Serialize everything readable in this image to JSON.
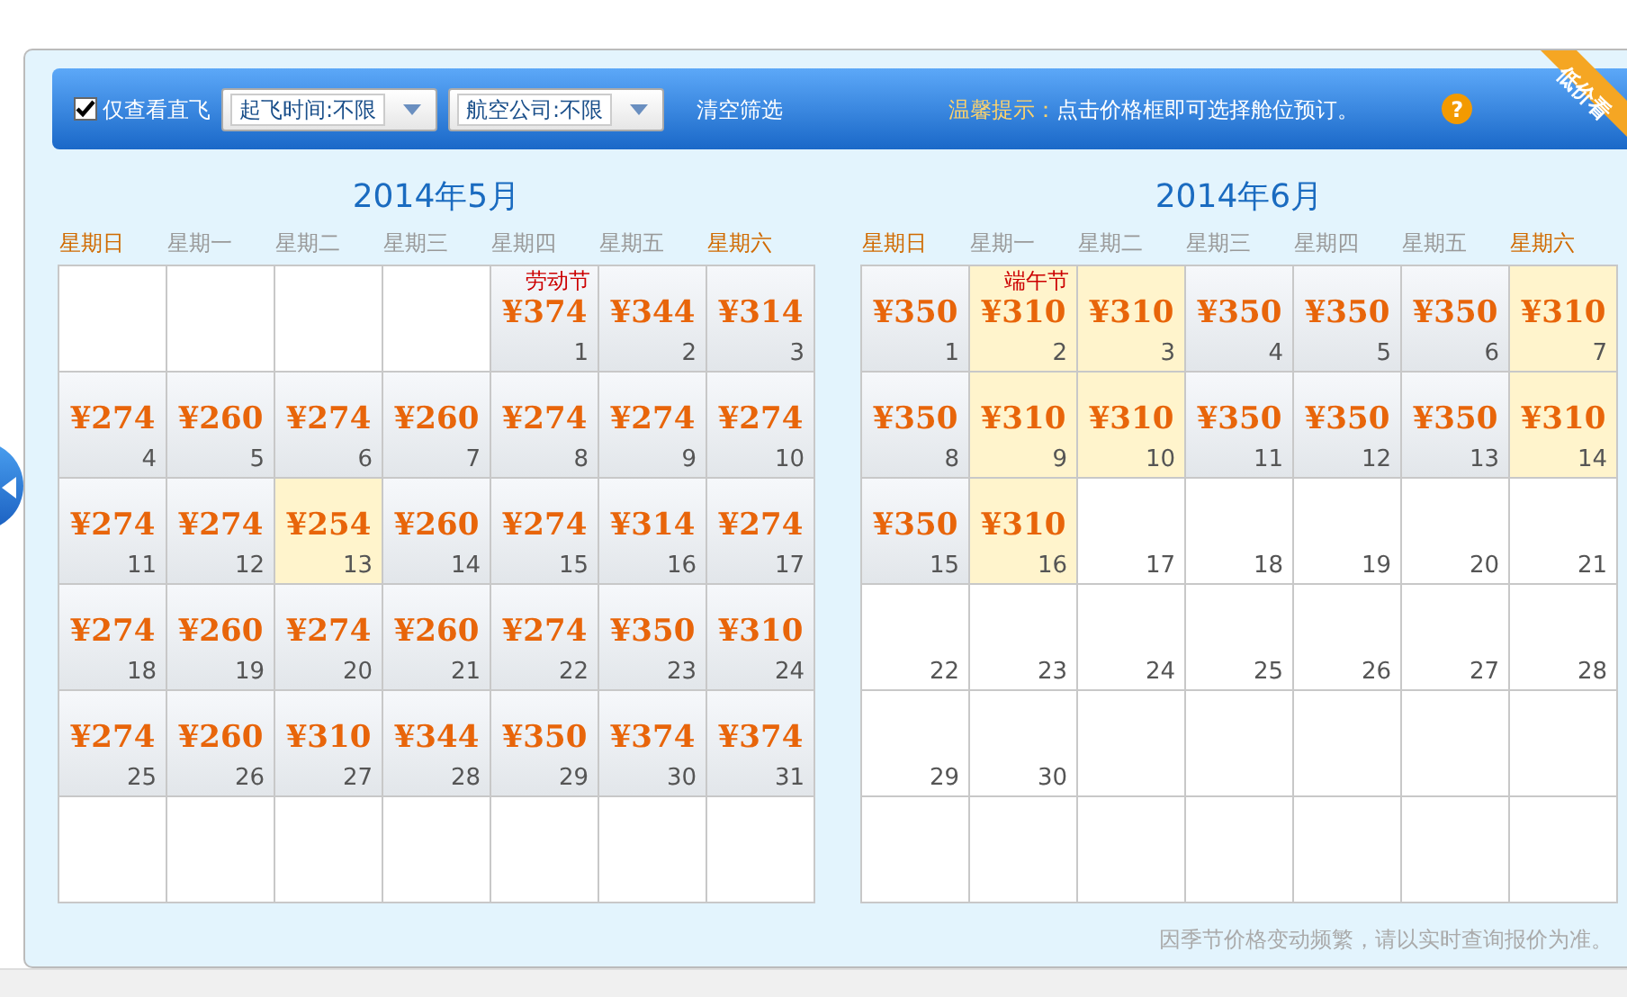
{
  "toolbar": {
    "direct_only": {
      "label": "仅查看直飞",
      "checked": true
    },
    "selects": [
      {
        "value": "起飞时间:不限"
      },
      {
        "value": "航空公司:不限"
      }
    ],
    "clear": "清空筛选",
    "tip_label": "温馨提示：",
    "tip": "点击价格框即可选择舱位预订。",
    "ribbon": "低价看",
    "help": "?"
  },
  "calendars": [
    {
      "title": "2014年5月",
      "weekdays": [
        {
          "label": "星期日",
          "weekend": true
        },
        {
          "label": "星期一",
          "weekend": false
        },
        {
          "label": "星期二",
          "weekend": false
        },
        {
          "label": "星期三",
          "weekend": false
        },
        {
          "label": "星期四",
          "weekend": false
        },
        {
          "label": "星期五",
          "weekend": false
        },
        {
          "label": "星期六",
          "weekend": true
        }
      ],
      "weeks": [
        [
          {
            "kind": "blank"
          },
          {
            "kind": "blank"
          },
          {
            "kind": "blank"
          },
          {
            "kind": "blank"
          },
          {
            "kind": "price",
            "holiday": "劳动节",
            "price": "¥374",
            "day": "1",
            "low": false
          },
          {
            "kind": "price",
            "price": "¥344",
            "day": "2",
            "low": false
          },
          {
            "kind": "price",
            "price": "¥314",
            "day": "3",
            "low": false
          }
        ],
        [
          {
            "kind": "price",
            "price": "¥274",
            "day": "4",
            "low": false
          },
          {
            "kind": "price",
            "price": "¥260",
            "day": "5",
            "low": false
          },
          {
            "kind": "price",
            "price": "¥274",
            "day": "6",
            "low": false
          },
          {
            "kind": "price",
            "price": "¥260",
            "day": "7",
            "low": false
          },
          {
            "kind": "price",
            "price": "¥274",
            "day": "8",
            "low": false
          },
          {
            "kind": "price",
            "price": "¥274",
            "day": "9",
            "low": false
          },
          {
            "kind": "price",
            "price": "¥274",
            "day": "10",
            "low": false
          }
        ],
        [
          {
            "kind": "price",
            "price": "¥274",
            "day": "11",
            "low": false
          },
          {
            "kind": "price",
            "price": "¥274",
            "day": "12",
            "low": false
          },
          {
            "kind": "price",
            "price": "¥254",
            "day": "13",
            "low": true
          },
          {
            "kind": "price",
            "price": "¥260",
            "day": "14",
            "low": false
          },
          {
            "kind": "price",
            "price": "¥274",
            "day": "15",
            "low": false
          },
          {
            "kind": "price",
            "price": "¥314",
            "day": "16",
            "low": false
          },
          {
            "kind": "price",
            "price": "¥274",
            "day": "17",
            "low": false
          }
        ],
        [
          {
            "kind": "price",
            "price": "¥274",
            "day": "18",
            "low": false
          },
          {
            "kind": "price",
            "price": "¥260",
            "day": "19",
            "low": false
          },
          {
            "kind": "price",
            "price": "¥274",
            "day": "20",
            "low": false
          },
          {
            "kind": "price",
            "price": "¥260",
            "day": "21",
            "low": false
          },
          {
            "kind": "price",
            "price": "¥274",
            "day": "22",
            "low": false
          },
          {
            "kind": "price",
            "price": "¥350",
            "day": "23",
            "low": false
          },
          {
            "kind": "price",
            "price": "¥310",
            "day": "24",
            "low": false
          }
        ],
        [
          {
            "kind": "price",
            "price": "¥274",
            "day": "25",
            "low": false
          },
          {
            "kind": "price",
            "price": "¥260",
            "day": "26",
            "low": false
          },
          {
            "kind": "price",
            "price": "¥310",
            "day": "27",
            "low": false
          },
          {
            "kind": "price",
            "price": "¥344",
            "day": "28",
            "low": false
          },
          {
            "kind": "price",
            "price": "¥350",
            "day": "29",
            "low": false
          },
          {
            "kind": "price",
            "price": "¥374",
            "day": "30",
            "low": false
          },
          {
            "kind": "price",
            "price": "¥374",
            "day": "31",
            "low": false
          }
        ],
        [
          {
            "kind": "blank"
          },
          {
            "kind": "blank"
          },
          {
            "kind": "blank"
          },
          {
            "kind": "blank"
          },
          {
            "kind": "blank"
          },
          {
            "kind": "blank"
          },
          {
            "kind": "blank"
          }
        ]
      ]
    },
    {
      "title": "2014年6月",
      "weekdays": [
        {
          "label": "星期日",
          "weekend": true
        },
        {
          "label": "星期一",
          "weekend": false
        },
        {
          "label": "星期二",
          "weekend": false
        },
        {
          "label": "星期三",
          "weekend": false
        },
        {
          "label": "星期四",
          "weekend": false
        },
        {
          "label": "星期五",
          "weekend": false
        },
        {
          "label": "星期六",
          "weekend": true
        }
      ],
      "weeks": [
        [
          {
            "kind": "price",
            "price": "¥350",
            "day": "1",
            "low": false
          },
          {
            "kind": "price",
            "holiday": "端午节",
            "price": "¥310",
            "day": "2",
            "low": true
          },
          {
            "kind": "price",
            "price": "¥310",
            "day": "3",
            "low": true
          },
          {
            "kind": "price",
            "price": "¥350",
            "day": "4",
            "low": false
          },
          {
            "kind": "price",
            "price": "¥350",
            "day": "5",
            "low": false
          },
          {
            "kind": "price",
            "price": "¥350",
            "day": "6",
            "low": false
          },
          {
            "kind": "price",
            "price": "¥310",
            "day": "7",
            "low": true
          }
        ],
        [
          {
            "kind": "price",
            "price": "¥350",
            "day": "8",
            "low": false
          },
          {
            "kind": "price",
            "price": "¥310",
            "day": "9",
            "low": true
          },
          {
            "kind": "price",
            "price": "¥310",
            "day": "10",
            "low": true
          },
          {
            "kind": "price",
            "price": "¥350",
            "day": "11",
            "low": false
          },
          {
            "kind": "price",
            "price": "¥350",
            "day": "12",
            "low": false
          },
          {
            "kind": "price",
            "price": "¥350",
            "day": "13",
            "low": false
          },
          {
            "kind": "price",
            "price": "¥310",
            "day": "14",
            "low": true
          }
        ],
        [
          {
            "kind": "price",
            "price": "¥350",
            "day": "15",
            "low": false
          },
          {
            "kind": "price",
            "price": "¥310",
            "day": "16",
            "low": true
          },
          {
            "kind": "day",
            "day": "17"
          },
          {
            "kind": "day",
            "day": "18"
          },
          {
            "kind": "day",
            "day": "19"
          },
          {
            "kind": "day",
            "day": "20"
          },
          {
            "kind": "day",
            "day": "21"
          }
        ],
        [
          {
            "kind": "day",
            "day": "22"
          },
          {
            "kind": "day",
            "day": "23"
          },
          {
            "kind": "day",
            "day": "24"
          },
          {
            "kind": "day",
            "day": "25"
          },
          {
            "kind": "day",
            "day": "26"
          },
          {
            "kind": "day",
            "day": "27"
          },
          {
            "kind": "day",
            "day": "28"
          }
        ],
        [
          {
            "kind": "day",
            "day": "29"
          },
          {
            "kind": "day",
            "day": "30"
          },
          {
            "kind": "blank"
          },
          {
            "kind": "blank"
          },
          {
            "kind": "blank"
          },
          {
            "kind": "blank"
          },
          {
            "kind": "blank"
          }
        ],
        [
          {
            "kind": "blank"
          },
          {
            "kind": "blank"
          },
          {
            "kind": "blank"
          },
          {
            "kind": "blank"
          },
          {
            "kind": "blank"
          },
          {
            "kind": "blank"
          },
          {
            "kind": "blank"
          }
        ]
      ]
    }
  ],
  "note": "因季节价格变动频繁，请以实时查询报价为准。"
}
